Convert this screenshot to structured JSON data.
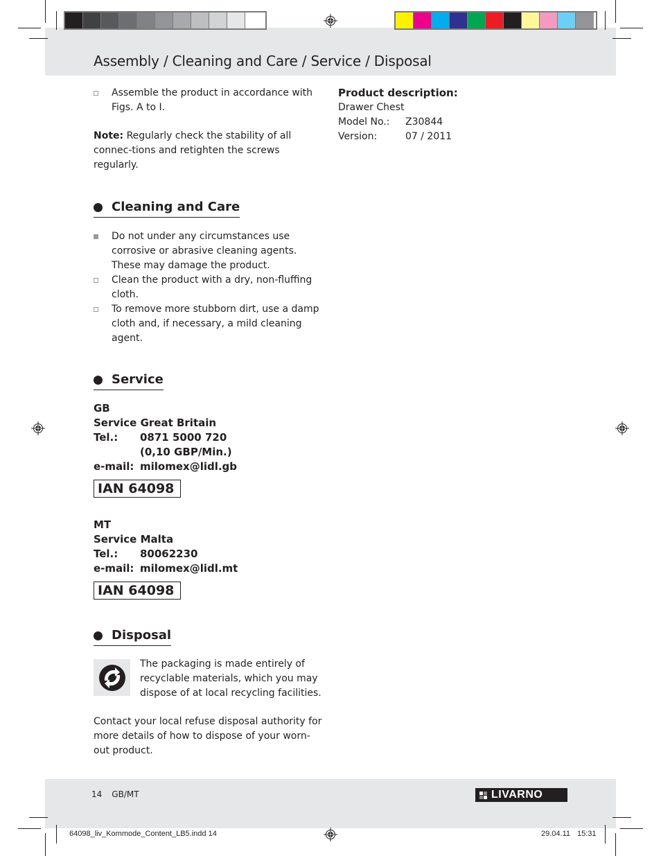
{
  "color_bars": {
    "grayscale": [
      "#231f20",
      "#414042",
      "#58595b",
      "#6d6e71",
      "#808285",
      "#939598",
      "#a7a9ac",
      "#bcbec0",
      "#d1d3d4",
      "#e6e7e8",
      "#ffffff"
    ],
    "process": [
      "#fff200",
      "#ec008c",
      "#00aeef",
      "#2e3192",
      "#00a651",
      "#ed1c24",
      "#231f20",
      "#fff799",
      "#f49ac1",
      "#6dcff6",
      "#939598"
    ]
  },
  "header": {
    "title": "Assembly / Cleaning and Care / Service / Disposal"
  },
  "assembly": {
    "step": "Assemble the product in accordance with Figs. A to I.",
    "note_label": "Note:",
    "note_text": " Regularly check the stability of all connec-tions and retighten the screws regularly."
  },
  "product": {
    "heading": "Product description:",
    "name": "Drawer Chest",
    "model_label": "Model No.:",
    "model_value": "Z30844",
    "version_label": "Version:",
    "version_value": "07 / 2011"
  },
  "cleaning": {
    "heading": "Cleaning and Care",
    "items": [
      {
        "style": "filled",
        "text": "Do not under any circumstances use corrosive or abrasive cleaning agents. These may damage the product."
      },
      {
        "style": "outline",
        "text": "Clean the product with a dry, non-fluffing cloth."
      },
      {
        "style": "outline",
        "text": "To remove more stubborn dirt, use a damp cloth and, if necessary, a mild cleaning agent."
      }
    ]
  },
  "service": {
    "heading": "Service",
    "gb": {
      "country": "GB",
      "name": "Service Great Britain",
      "tel_label": "Tel.:",
      "tel": "0871 5000 720",
      "rate": "(0,10 GBP/Min.)",
      "email_label": "e-mail:",
      "email": "milomex@lidl.gb",
      "ian": "IAN 64098"
    },
    "mt": {
      "country": "MT",
      "name": "Service Malta",
      "tel_label": "Tel.:",
      "tel": "80062230",
      "email_label": "e-mail:",
      "email": "milomex@lidl.mt",
      "ian": "IAN 64098"
    }
  },
  "disposal": {
    "heading": "Disposal",
    "icon": "green-dot-recycling-icon",
    "packaging_text": "The packaging is made entirely of recyclable materials, which you may dispose of at local recycling facilities.",
    "contact_text": "Contact your local refuse disposal authority for more details of how to dispose of your worn-out product."
  },
  "footer": {
    "page_number": "14",
    "language": "GB/MT",
    "brand": "LIVARNO",
    "slug_file": "64098_liv_Kommode_Content_LB5.indd   14",
    "slug_date": "29.04.11",
    "slug_time": "15:31"
  }
}
